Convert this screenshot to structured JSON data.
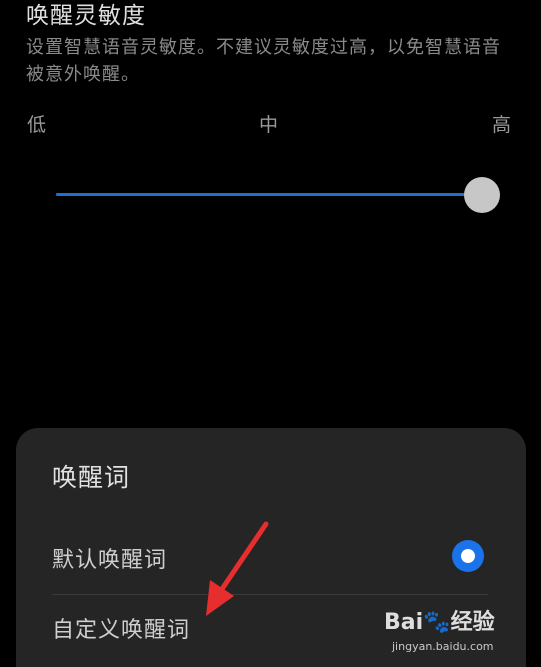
{
  "sensitivity": {
    "title": "唤醒灵敏度",
    "description": "设置智慧语音灵敏度。不建议灵敏度过高，以免智慧语音被意外唤醒。",
    "labels": {
      "low": "低",
      "mid": "中",
      "high": "高"
    },
    "level_fraction": 0.96,
    "accent_color": "#1f6fd1"
  },
  "wake_word_sheet": {
    "title": "唤醒词",
    "options": [
      {
        "label": "默认唤醒词",
        "selected": true
      },
      {
        "label": "自定义唤醒词",
        "selected": false
      }
    ]
  },
  "annotation": {
    "arrow_color": "#e62e2e",
    "arrow_icon": "red-arrow-icon"
  },
  "watermark": {
    "logo_text_a": "Bai",
    "logo_paw": "🐾",
    "logo_text_b": "经验",
    "url": "jingyan.baidu.com"
  }
}
